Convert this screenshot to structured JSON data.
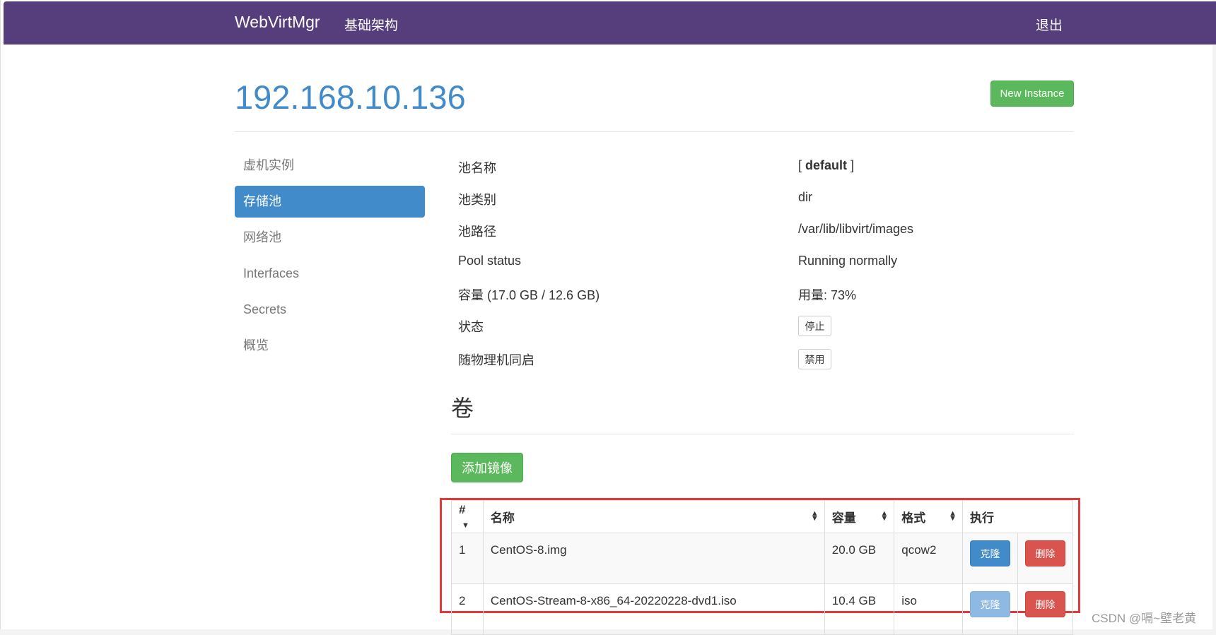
{
  "navbar": {
    "brand": "WebVirtMgr",
    "infra_link": "基础架构",
    "logout_link": "退出",
    "color": "#563d7c"
  },
  "header": {
    "host": "192.168.10.136",
    "new_instance_label": "New Instance"
  },
  "sidebar": {
    "items": [
      {
        "label": "虚机实例",
        "active": false
      },
      {
        "label": "存储池",
        "active": true
      },
      {
        "label": "网络池",
        "active": false
      },
      {
        "label": "Interfaces",
        "active": false
      },
      {
        "label": "Secrets",
        "active": false
      },
      {
        "label": "概览",
        "active": false
      }
    ]
  },
  "pool_info": {
    "name_label": "池名称",
    "name_prefix": "[ ",
    "name_value": "default",
    "name_suffix": " ]",
    "type_label": "池类别",
    "type_value": "dir",
    "path_label": "池路径",
    "path_value": "/var/lib/libvirt/images",
    "status_label": "Pool status",
    "status_value": "Running normally",
    "capacity_label": "容量 (17.0 GB / 12.6 GB)",
    "usage_value": "用量: 73%",
    "state_label": "状态",
    "state_button": "停止",
    "autostart_label": "随物理机同启",
    "autostart_button": "禁用"
  },
  "volumes": {
    "heading": "卷",
    "add_button": "添加镜像",
    "columns": [
      "#",
      "名称",
      "容量",
      "格式",
      "执行"
    ],
    "rows": [
      {
        "num": "1",
        "name": "CentOS-8.img",
        "size": "20.0 GB",
        "format": "qcow2",
        "clone": "克隆",
        "delete": "删除"
      },
      {
        "num": "2",
        "name": "CentOS-Stream-8-x86_64-20220228-dvd1.iso",
        "size": "10.4 GB",
        "format": "iso",
        "clone": "克隆",
        "delete": "删除"
      }
    ]
  },
  "watermark": "CSDN @嗝~壁老黄"
}
